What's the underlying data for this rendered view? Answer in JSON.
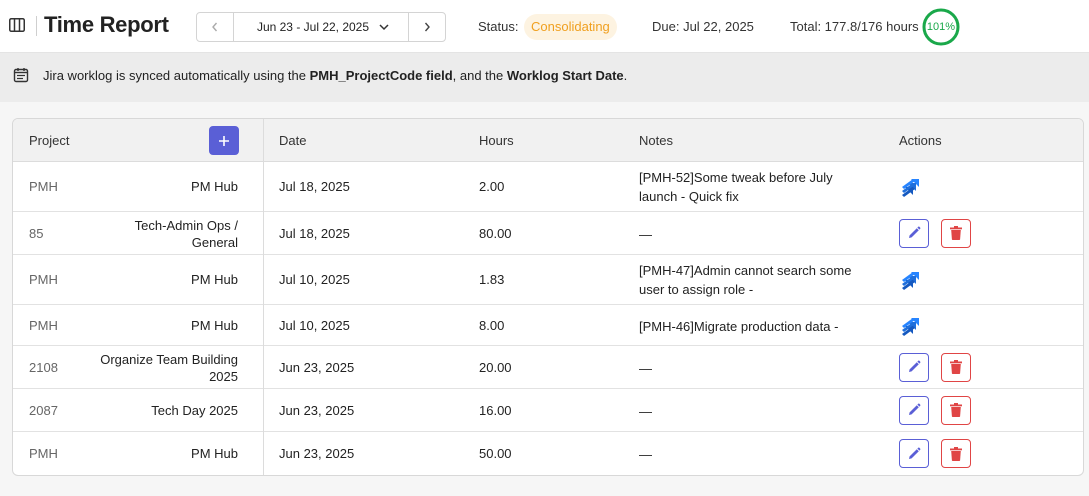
{
  "header": {
    "title": "Time Report",
    "date_range": "Jun 23 - Jul 22, 2025",
    "status_label": "Status:",
    "status_value": "Consolidating",
    "due": "Due: Jul 22, 2025",
    "total": "Total: 177.8/176 hours",
    "progress_percent": "101%",
    "progress_fraction": 1.01
  },
  "info": {
    "text_before": "Jira worklog is synced automatically using the ",
    "field_1": "PMH_ProjectCode field",
    "text_middle": ", and the ",
    "field_2": "Worklog Start Date",
    "text_after": "."
  },
  "table": {
    "columns": {
      "project": "Project",
      "date": "Date",
      "hours": "Hours",
      "notes": "Notes",
      "actions": "Actions"
    },
    "rows": [
      {
        "code": "PMH",
        "project": "PM Hub",
        "date": "Jul 18, 2025",
        "hours": "2.00",
        "notes": "[PMH-52]Some tweak before July launch - Quick fix",
        "action": "jira"
      },
      {
        "code": "85",
        "project": "Tech-Admin Ops / General",
        "date": "Jul 18, 2025",
        "hours": "80.00",
        "notes": "—",
        "action": "edit-delete"
      },
      {
        "code": "PMH",
        "project": "PM Hub",
        "date": "Jul 10, 2025",
        "hours": "1.83",
        "notes": "[PMH-47]Admin cannot search some user to assign role -",
        "action": "jira"
      },
      {
        "code": "PMH",
        "project": "PM Hub",
        "date": "Jul 10, 2025",
        "hours": "8.00",
        "notes": "[PMH-46]Migrate production data -",
        "action": "jira"
      },
      {
        "code": "2108",
        "project": "Organize Team Building 2025",
        "date": "Jun 23, 2025",
        "hours": "20.00",
        "notes": "—",
        "action": "edit-delete"
      },
      {
        "code": "2087",
        "project": "Tech Day 2025",
        "date": "Jun 23, 2025",
        "hours": "16.00",
        "notes": "—",
        "action": "edit-delete"
      },
      {
        "code": "PMH",
        "project": "PM Hub",
        "date": "Jun 23, 2025",
        "hours": "50.00",
        "notes": "—",
        "action": "edit-delete"
      }
    ]
  },
  "colors": {
    "accent": "#5a5fd6",
    "status": "#f0a020",
    "progress": "#1aa84a",
    "danger": "#e04545",
    "jira": "#2684ff"
  },
  "icons": {
    "sidebar": "sidebar-toggle-icon",
    "prev": "chevron-left-icon",
    "next": "chevron-right-icon",
    "dropdown": "chevron-down-icon",
    "info": "calendar-icon",
    "add": "plus-icon",
    "jira": "jira-icon",
    "edit": "pencil-icon",
    "delete": "trash-icon"
  }
}
